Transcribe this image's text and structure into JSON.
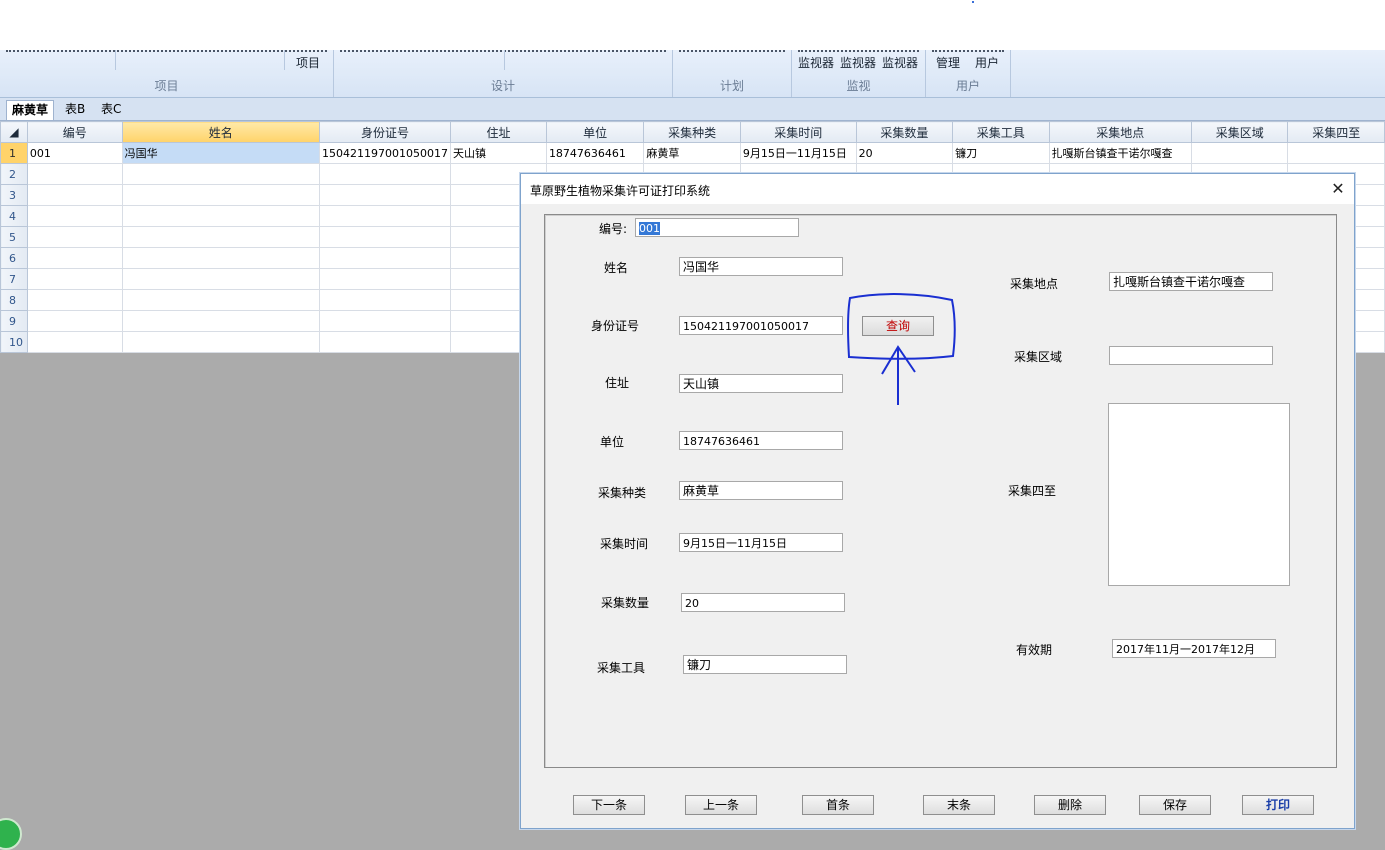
{
  "ribbon": {
    "groups": [
      {
        "label": "项目",
        "buttons": [
          "项目"
        ]
      },
      {
        "label": "设计",
        "buttons": []
      },
      {
        "label": "计划",
        "buttons": []
      },
      {
        "label": "监视",
        "buttons": [
          "监视器",
          "监视器",
          "监视器"
        ]
      },
      {
        "label": "用户",
        "buttons": [
          "管理",
          "用户"
        ]
      }
    ]
  },
  "sheet_tabs": [
    "麻黄草",
    "表B",
    "表C"
  ],
  "grid": {
    "columns": [
      "编号",
      "姓名",
      "身份证号",
      "住址",
      "单位",
      "采集种类",
      "采集时间",
      "采集数量",
      "采集工具",
      "采集地点",
      "采集区域",
      "采集四至"
    ],
    "row_numbers": [
      "1",
      "2",
      "3",
      "4",
      "5",
      "6",
      "7",
      "8",
      "9",
      "10"
    ],
    "rows": [
      [
        "001",
        "冯国华",
        "150421197001050017",
        "天山镇",
        "18747636461",
        "麻黄草",
        "9月15日一11月15日",
        "20",
        "镰刀",
        "扎嘎斯台镇查干诺尔嘎查",
        "",
        ""
      ]
    ]
  },
  "dialog": {
    "title": "草原野生植物采集许可证打印系统",
    "close_glyph": "✕",
    "labels": {
      "id": "编号:",
      "name": "姓名",
      "idcard": "身份证号",
      "address": "住址",
      "unit": "单位",
      "kind": "采集种类",
      "time": "采集时间",
      "quantity": "采集数量",
      "tool": "采集工具",
      "place": "采集地点",
      "region": "采集区域",
      "boundary": "采集四至",
      "validity": "有效期"
    },
    "values": {
      "id": "001",
      "name": "冯国华",
      "idcard": "150421197001050017",
      "address": "天山镇",
      "unit": "18747636461",
      "kind": "麻黄草",
      "time": "9月15日一11月15日",
      "quantity": "20",
      "tool": "镰刀",
      "place": "扎嘎斯台镇查干诺尔嘎查",
      "region": "",
      "boundary": "",
      "validity": "2017年11月一2017年12月"
    },
    "query_button": "查询",
    "buttons": {
      "next": "下一条",
      "prev": "上一条",
      "first": "首条",
      "last": "末条",
      "delete": "删除",
      "save": "保存",
      "print": "打印"
    }
  },
  "colors": {
    "annotation": "#1a2fd1",
    "query_text": "#c00000"
  }
}
